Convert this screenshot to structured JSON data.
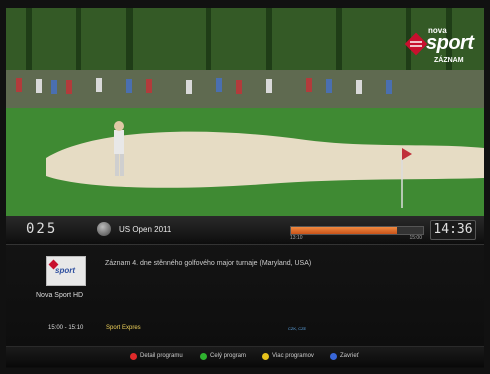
{
  "overlay_logo": {
    "top": "nova",
    "brand": "sport",
    "sub": "ZÁZNAM"
  },
  "osd": {
    "channel_number": "025",
    "program_title": "US Open 2011",
    "progress": {
      "start": "13:10",
      "end": "15:00",
      "fraction": 0.8
    },
    "clock": "14:36",
    "channel_logo_text": "sport",
    "channel_name": "Nova Sport HD",
    "description": "Záznam 4. dne stěnného golfového major turnaje (Maryland, USA)",
    "next": {
      "time": "15:00 - 15:10",
      "title": "Sport Expres",
      "tags": "CZK, CZE"
    },
    "buttons": [
      {
        "label": "Detail programu",
        "color": "#e02a2a"
      },
      {
        "label": "Celý program",
        "color": "#2fb32f"
      },
      {
        "label": "Viac programov",
        "color": "#e6c21c"
      },
      {
        "label": "Zavrieť",
        "color": "#3866d8"
      }
    ]
  }
}
